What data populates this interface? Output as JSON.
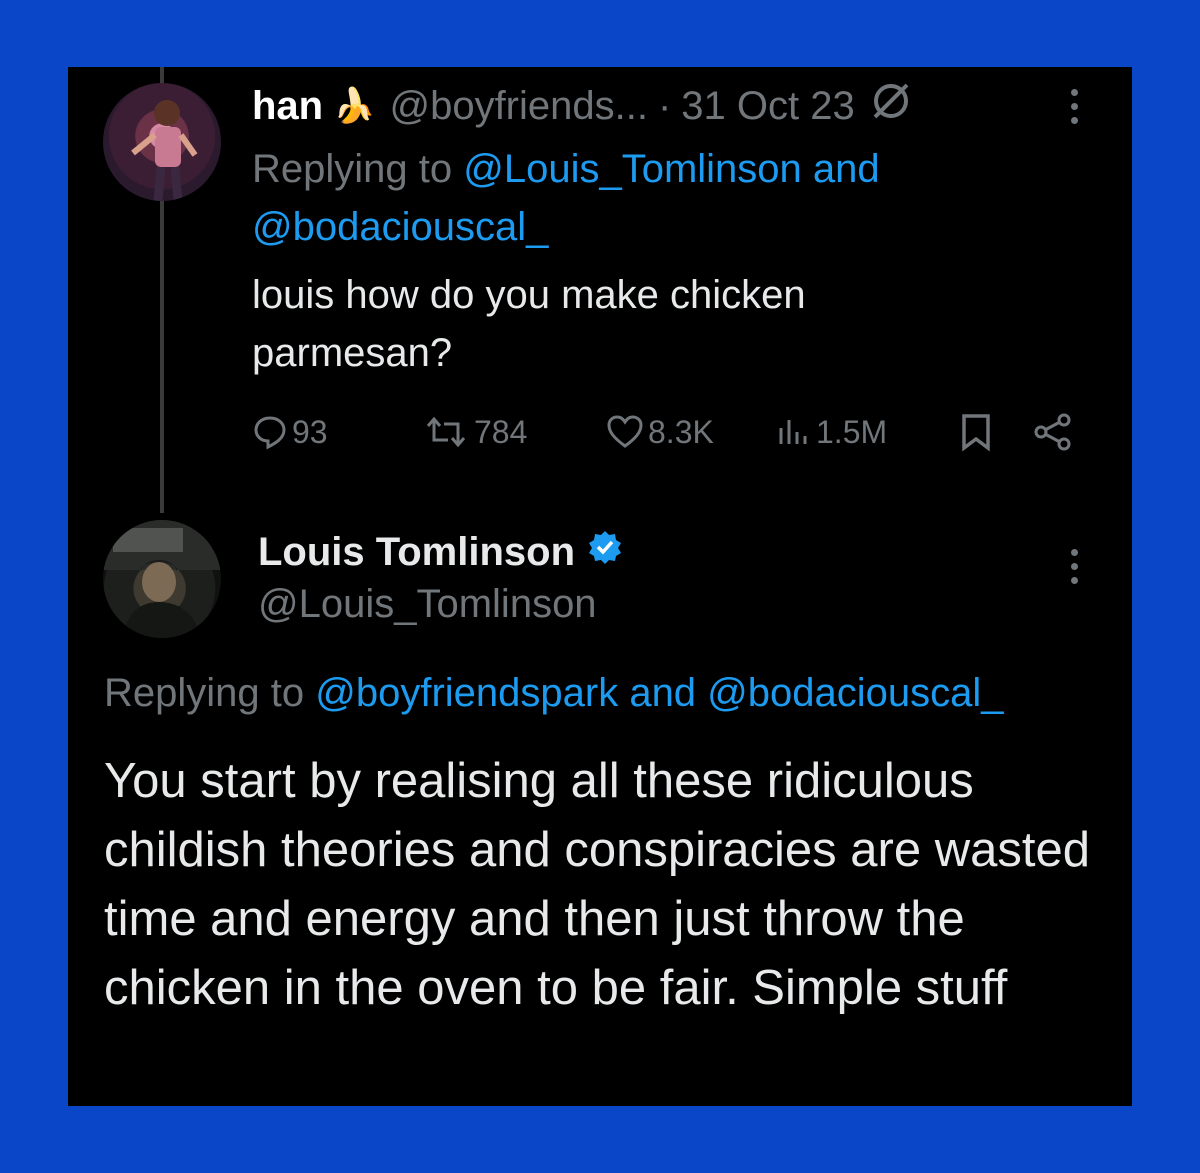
{
  "colors": {
    "frame": "#0a46c8",
    "background": "#000000",
    "link": "#1d9bf0",
    "muted": "#71767b",
    "text": "#e7e9ea",
    "verified": "#1d9bf0"
  },
  "parent_tweet": {
    "display_name": "han",
    "emoji": "🍌",
    "handle": "@boyfriends...",
    "separator": "·",
    "date": "31 Oct 23",
    "status_icon": "muted-circle-slash-icon",
    "replying_prefix": "Replying to ",
    "replying_user1": "@Louis_Tomlinson",
    "replying_and": " and ",
    "replying_user2": "@bodaciouscal_",
    "text": "louis how do you make chicken parmesan?",
    "stats": {
      "replies": "93",
      "retweets": "784",
      "likes": "8.3K",
      "views": "1.5M"
    },
    "icons": {
      "reply": "speech-bubble-icon",
      "retweet": "retweet-icon",
      "like": "heart-icon",
      "views": "bar-chart-icon",
      "bookmark": "bookmark-icon",
      "share": "share-icon",
      "more": "more-vertical-icon"
    }
  },
  "reply_tweet": {
    "display_name": "Louis Tomlinson",
    "verified_icon": "verified-badge-icon",
    "handle": "@Louis_Tomlinson",
    "replying_prefix": "Replying to ",
    "replying_user1": "@boyfriendspark",
    "replying_and": " and ",
    "replying_user2": "@bodaciouscal_",
    "text": "You start by realising all these ridiculous childish theories and conspiracies are wasted time and energy and then just throw the chicken in the oven to be fair. Simple stuff"
  }
}
